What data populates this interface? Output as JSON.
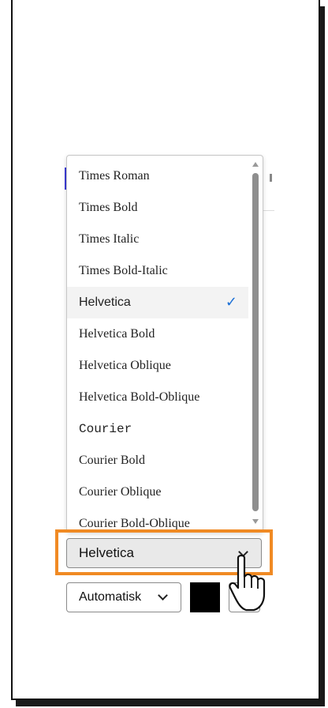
{
  "font_dropdown": {
    "items": [
      {
        "label": "Times Roman",
        "style": "serif"
      },
      {
        "label": "Times Bold",
        "style": "serif"
      },
      {
        "label": "Times Italic",
        "style": "serif"
      },
      {
        "label": "Times Bold-Italic",
        "style": "serif"
      },
      {
        "label": "Helvetica",
        "style": "sans",
        "selected": true
      },
      {
        "label": "Helvetica Bold",
        "style": "serif"
      },
      {
        "label": "Helvetica Oblique",
        "style": "serif"
      },
      {
        "label": "Helvetica Bold-Oblique",
        "style": "serif"
      },
      {
        "label": "Courier",
        "style": "mono"
      },
      {
        "label": "Courier Bold",
        "style": "serif"
      },
      {
        "label": "Courier Oblique",
        "style": "serif"
      },
      {
        "label": "Courier Bold-Oblique",
        "style": "serif"
      }
    ],
    "check_glyph": "✓"
  },
  "font_select": {
    "value": "Helvetica"
  },
  "size_select": {
    "value": "Automatisk"
  },
  "colors": {
    "highlight": "#f08a24",
    "check": "#1a6fd6",
    "swatch": "#000000"
  },
  "icons": {
    "cursor": "hand-pointer-icon",
    "chevron": "chevron-down-icon"
  }
}
